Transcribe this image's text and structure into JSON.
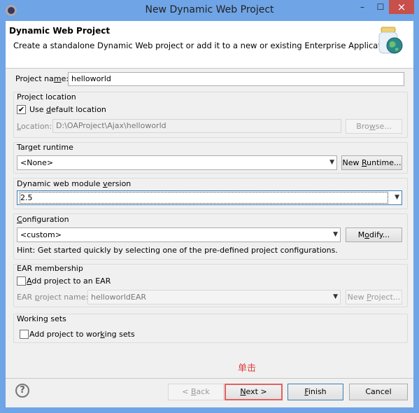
{
  "window": {
    "title": "New Dynamic Web Project",
    "minimize": "–",
    "maximize": "☐",
    "close": "×",
    "border_color": "#6fa4e6",
    "close_color": "#c7504b"
  },
  "header": {
    "title": "Dynamic Web Project",
    "description": "Create a standalone Dynamic Web project or add it to a new or existing Enterprise Application.",
    "icon": "web-project-jar-globe-icon"
  },
  "project_name": {
    "label_pre": "Project na",
    "label_u": "m",
    "label_post": "e:",
    "value": "helloworld"
  },
  "project_location": {
    "group": "Project location",
    "use_default_pre": "Use ",
    "use_default_u": "d",
    "use_default_post": "efault location",
    "use_default_checked": true,
    "location_u": "L",
    "location_post": "ocation:",
    "location_value": "D:\\OAProject\\Ajax\\helloworld",
    "browse_pre": "Bro",
    "browse_u": "w",
    "browse_post": "se..."
  },
  "target_runtime": {
    "group": "Target runtime",
    "value": "<None>",
    "button_pre": "New ",
    "button_u": "R",
    "button_post": "untime..."
  },
  "module_version": {
    "group_pre": "Dynamic web module ",
    "group_u": "v",
    "group_post": "ersion",
    "value": "2.5"
  },
  "configuration": {
    "group_u": "C",
    "group_post": "onfiguration",
    "value": "<custom>",
    "button_pre": "M",
    "button_u": "o",
    "button_post": "dify...",
    "hint": "Hint: Get started quickly by selecting one of the pre-defined project configurations."
  },
  "ear": {
    "group": "EAR membership",
    "add_u": "A",
    "add_post": "dd project to an EAR",
    "add_checked": false,
    "name_pre": "EAR ",
    "name_u": "p",
    "name_post": "roject name:",
    "name_value": "helloworldEAR",
    "button_pre": "New ",
    "button_u": "P",
    "button_post": "roject..."
  },
  "working_sets": {
    "group": "Working sets",
    "add_pre": "Add project to wor",
    "add_u": "k",
    "add_post": "ing sets",
    "add_checked": false
  },
  "annotation": {
    "text": "单击",
    "color": "#e04040"
  },
  "buttons": {
    "back_pre": "< ",
    "back_u": "B",
    "back_post": "ack",
    "next_u": "N",
    "next_post": "ext >",
    "finish_u": "F",
    "finish_post": "inish",
    "cancel": "Cancel"
  }
}
